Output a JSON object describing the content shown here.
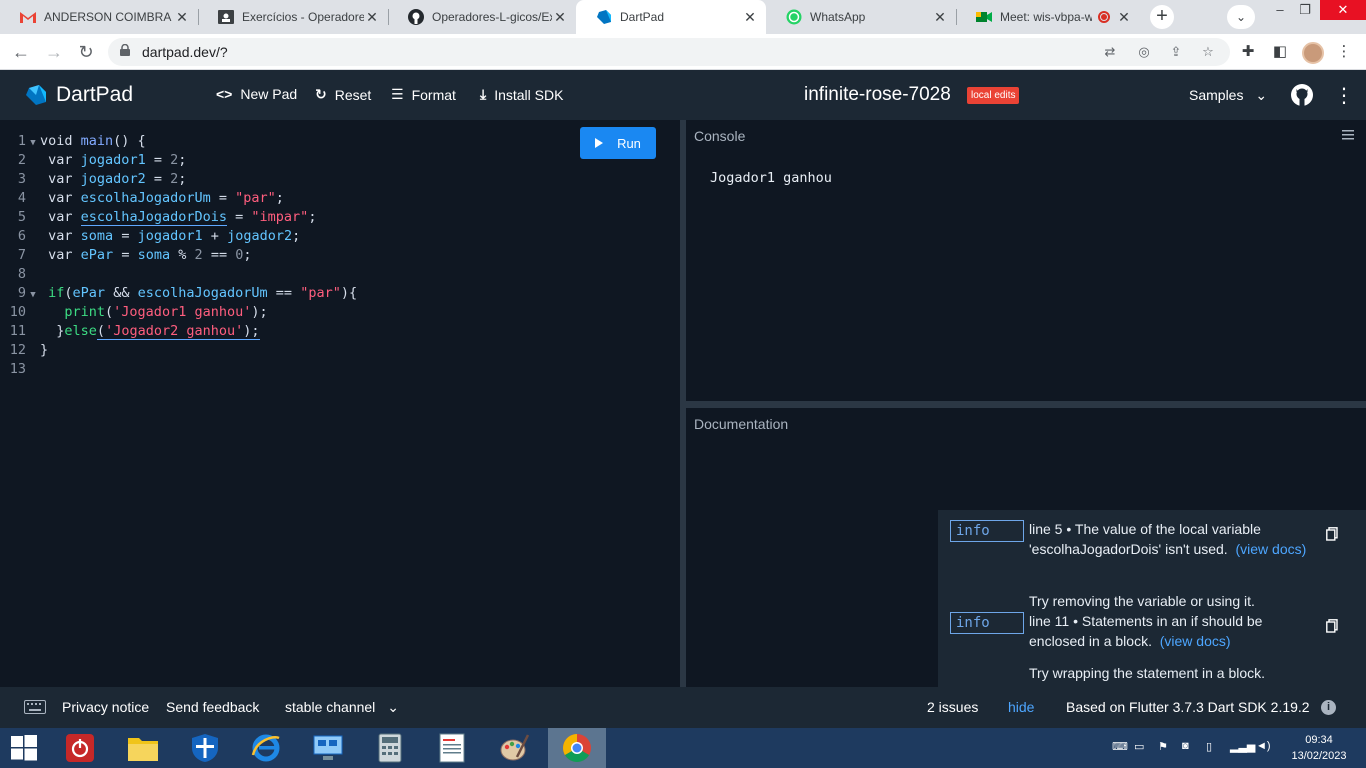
{
  "browser": {
    "tabs": [
      {
        "title": "ANDERSON COIMBRA",
        "favicon": "gmail-icon"
      },
      {
        "title": "Exercícios - Operadores",
        "favicon": "classroom-icon"
      },
      {
        "title": "Operadores-L-gicos/Exe",
        "favicon": "github-icon"
      },
      {
        "title": "DartPad",
        "favicon": "dart-icon",
        "active": true
      },
      {
        "title": "WhatsApp",
        "favicon": "whatsapp-icon"
      },
      {
        "title": "Meet: wis-vbpa-wz",
        "favicon": "meet-icon"
      }
    ],
    "url": "dartpad.dev/?"
  },
  "header": {
    "brand": "DartPad",
    "new_pad": "New Pad",
    "reset": "Reset",
    "format": "Format",
    "install_sdk": "Install SDK",
    "pad_title": "infinite-rose-7028",
    "badge": "local edits",
    "samples": "Samples"
  },
  "editor": {
    "run_label": "Run",
    "line_numbers": [
      "1",
      "2",
      "3",
      "4",
      "5",
      "6",
      "7",
      "8",
      "9",
      "10",
      "11",
      "12",
      "13"
    ]
  },
  "console": {
    "label": "Console",
    "output": "Jogador1 ganhou"
  },
  "documentation": {
    "label": "Documentation"
  },
  "issues": [
    {
      "severity": "info",
      "message": "line 5 • The value of the local variable 'escolhaJogadorDois' isn't used.",
      "link": "(view docs)",
      "fix": "Try removing the variable or using it."
    },
    {
      "severity": "info",
      "message": "line 11 • Statements in an if should be enclosed in a block.",
      "link": "(view docs)",
      "fix": "Try wrapping the statement in a block."
    }
  ],
  "footer": {
    "privacy": "Privacy notice",
    "feedback": "Send feedback",
    "channel": "stable channel",
    "issues_count": "2 issues",
    "hide": "hide",
    "sdk_info": "Based on Flutter 3.7.3 Dart SDK 2.19.2"
  },
  "taskbar": {
    "time": "09:34",
    "date": "13/02/2023"
  },
  "colors": {
    "header_bg": "#1c2834",
    "editor_bg": "#0f1722",
    "run_button": "#1a88f2",
    "badge": "#ea4335",
    "link": "#4da6ff"
  }
}
